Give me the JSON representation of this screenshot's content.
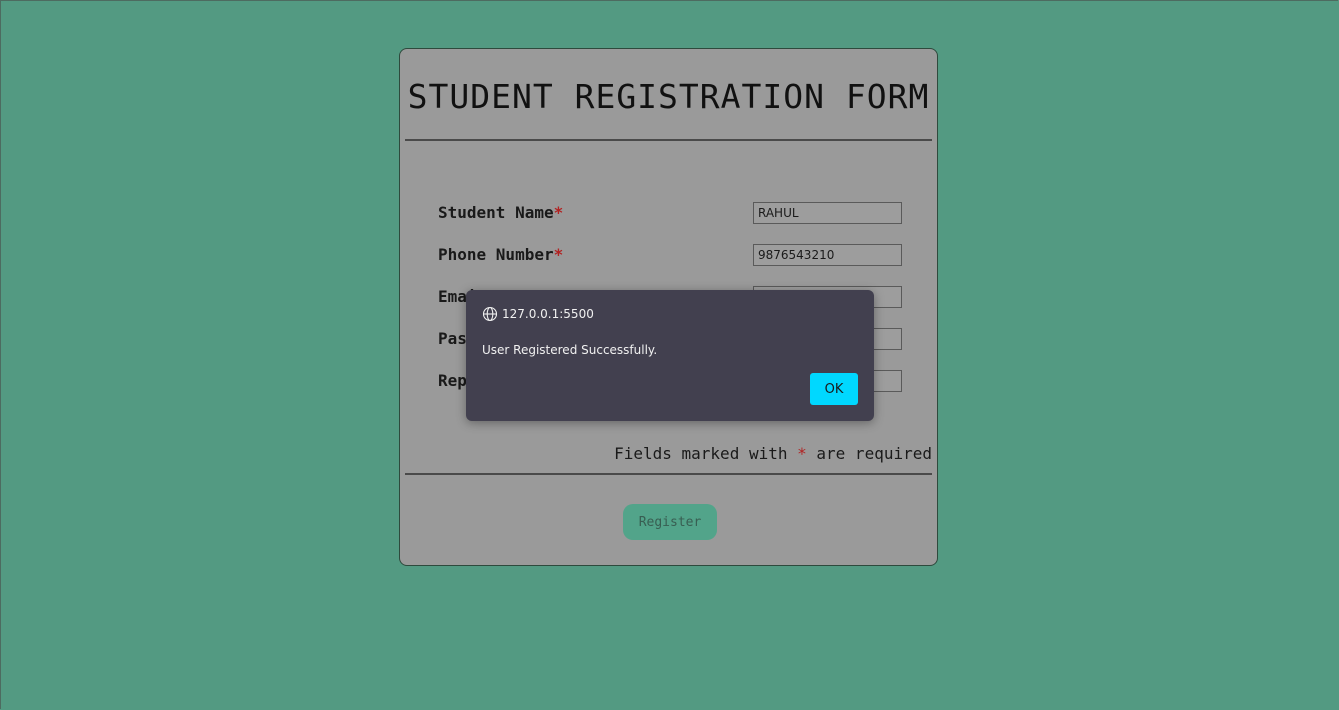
{
  "form": {
    "title": "STUDENT REGISTRATION FORM",
    "required_marker": "*",
    "fields": [
      {
        "label": "Student Name",
        "value": "RAHUL"
      },
      {
        "label": "Phone Number",
        "value": "9876543210"
      },
      {
        "label": "Email",
        "value": ""
      },
      {
        "label": "Password",
        "value": ""
      },
      {
        "label": "Repeat Password",
        "value": ""
      }
    ],
    "required_note": {
      "before": "Fields marked with ",
      "marker": "*",
      "after": " are required"
    },
    "register_label": "Register"
  },
  "dialog": {
    "origin": "127.0.0.1:5500",
    "message": "User Registered Successfully.",
    "ok_label": "OK",
    "icon": "globe-icon"
  },
  "colors": {
    "page_background": "#539a82",
    "card_background": "#9a9a9a",
    "dialog_background": "#42404f",
    "ok_button": "#00d8ff",
    "required_marker": "#b22222",
    "register_button": "#52a48a"
  }
}
